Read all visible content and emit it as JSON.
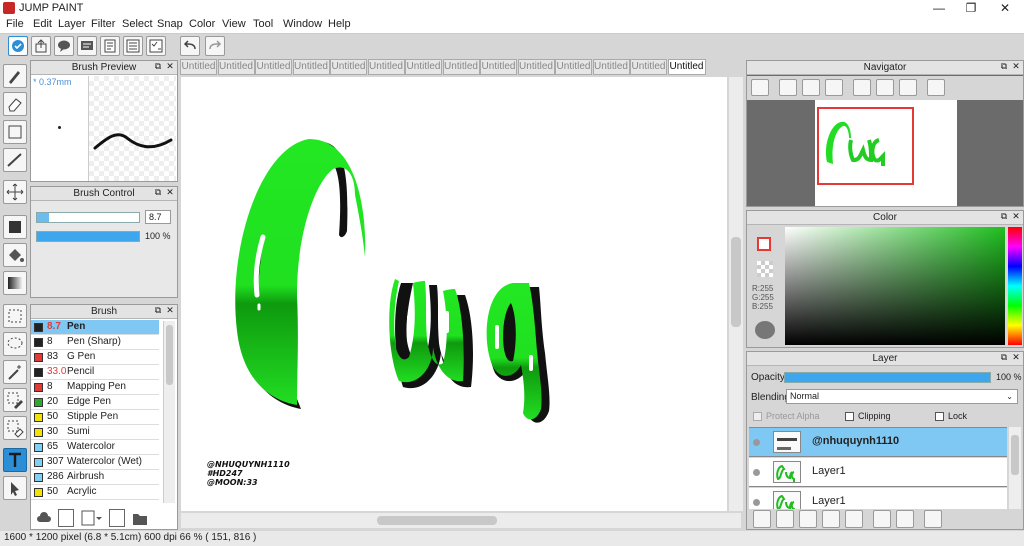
{
  "window": {
    "title": "JUMP PAINT",
    "minimize": "—",
    "restore": "❐",
    "close": "✕"
  },
  "menu": [
    "File",
    "Edit",
    "Layer",
    "Filter",
    "Select",
    "Snap",
    "Color",
    "View",
    "Tool",
    "Window",
    "Help"
  ],
  "menu_underline": [
    "F",
    "E",
    "L",
    "t",
    "S",
    "S",
    "C",
    "V",
    "T",
    "W",
    "H"
  ],
  "brush_preview": {
    "title": "Brush Preview",
    "size_label": "* 0.37mm"
  },
  "brush_control": {
    "title": "Brush Control",
    "size_value": "8.7",
    "opacity_value": "100 %",
    "size_fill": 0.12,
    "opacity_fill": 1.0
  },
  "brush": {
    "title": "Brush",
    "items": [
      {
        "size": "8.7",
        "name": "Pen",
        "color": "#222222",
        "size_red": true,
        "selected": true
      },
      {
        "size": "8",
        "name": "Pen (Sharp)",
        "color": "#222222"
      },
      {
        "size": "83",
        "name": "G Pen",
        "color": "#e53935"
      },
      {
        "size": "33.0",
        "name": "Pencil",
        "color": "#222222",
        "size_red": true
      },
      {
        "size": "8",
        "name": "Mapping Pen",
        "color": "#e53935"
      },
      {
        "size": "20",
        "name": "Edge Pen",
        "color": "#2eaa2e"
      },
      {
        "size": "50",
        "name": "Stipple Pen",
        "color": "#f2e300"
      },
      {
        "size": "30",
        "name": "Sumi",
        "color": "#f2e300"
      },
      {
        "size": "65",
        "name": "Watercolor",
        "color": "#7fd0f5"
      },
      {
        "size": "307",
        "name": "Watercolor (Wet)",
        "color": "#7fd0f5"
      },
      {
        "size": "286",
        "name": "Airbrush",
        "color": "#7fd0f5"
      },
      {
        "size": "50",
        "name": "Acrylic",
        "color": "#f2e300"
      }
    ]
  },
  "tabs": [
    "Untitled",
    "Untitled",
    "Untitled",
    "Untitled",
    "Untitled",
    "Untitled",
    "Untitled",
    "Untitled",
    "Untitled",
    "Untitled",
    "Untitled",
    "Untitled",
    "Untitled",
    "Untitled"
  ],
  "canvas": {
    "lettering": "Cuq",
    "signature": [
      "@NHUQUYNH1110",
      "#HD247",
      "@MOON:33"
    ]
  },
  "navigator": {
    "title": "Navigator"
  },
  "color": {
    "title": "Color",
    "r": "R:255",
    "g": "G:255",
    "b": "B:255"
  },
  "layer": {
    "title": "Layer",
    "opacity_label": "Opacity",
    "opacity_value": "100 %",
    "blending_label": "Blending",
    "blending_value": "Normal",
    "protect_alpha": "Protect Alpha",
    "clipping": "Clipping",
    "lock": "Lock",
    "items": [
      {
        "name": "@nhuquynh1110",
        "selected": true
      },
      {
        "name": "Layer1"
      },
      {
        "name": "Layer1"
      }
    ]
  },
  "status": "1600 * 1200 pixel   (6.8 * 5.1cm)   600 dpi   66 %   ( 151, 816 )",
  "colors": {
    "accent": "#7fc8f3",
    "green": "#22dd22",
    "selection": "#2b8ed7"
  }
}
